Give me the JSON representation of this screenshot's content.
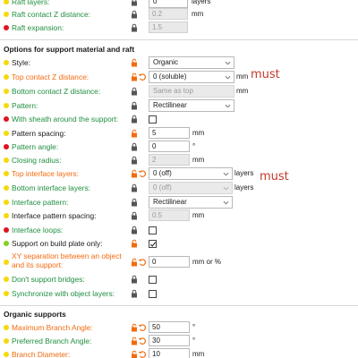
{
  "colors": {
    "dot_yellow": "#f5d90a",
    "dot_red": "#e0141e",
    "dot_green": "#7ed321",
    "label_orange": "#f26b0f",
    "label_green": "#1f8f3f",
    "label_black": "#1a1a1a",
    "annotation_red": "#c0392b"
  },
  "raft": {
    "layers": {
      "label": "Raft layers:",
      "value": "0",
      "unit": "layers"
    },
    "contact_z": {
      "label": "Raft contact Z distance:",
      "value": "0.2",
      "unit": "mm"
    },
    "expansion": {
      "label": "Raft expansion:",
      "value": "1.5"
    }
  },
  "support": {
    "section_title": "Options for support material and raft",
    "style": {
      "label": "Style:",
      "value": "Organic"
    },
    "top_contact_z": {
      "label": "Top contact Z distance:",
      "value": "0 (soluble)",
      "unit": "mm"
    },
    "bottom_contact_z": {
      "label": "Bottom contact Z distance:",
      "value": "Same as top",
      "unit": "mm"
    },
    "pattern": {
      "label": "Pattern:",
      "value": "Rectilinear"
    },
    "with_sheath": {
      "label": "With sheath around the support:"
    },
    "pattern_spacing": {
      "label": "Pattern spacing:",
      "value": "5",
      "unit": "mm"
    },
    "pattern_angle": {
      "label": "Pattern angle:",
      "value": "0",
      "unit": "°"
    },
    "closing_radius": {
      "label": "Closing radius:",
      "value": "2",
      "unit": "mm"
    },
    "top_interface_layers": {
      "label": "Top interface layers:",
      "value": "0 (off)",
      "unit": "layers"
    },
    "bottom_interface_layers": {
      "label": "Bottom interface layers:",
      "value": "0 (off)",
      "unit": "layers"
    },
    "interface_pattern": {
      "label": "Interface pattern:",
      "value": "Rectilinear"
    },
    "interface_pattern_spacing": {
      "label": "Interface pattern spacing:",
      "value": "0.5",
      "unit": "mm"
    },
    "interface_loops": {
      "label": "Interface loops:"
    },
    "build_plate_only": {
      "label": "Support on build plate only:",
      "checked": true
    },
    "xy_separation": {
      "label_line1": "XY separation between an object",
      "label_line2": "and its support:",
      "value": "0",
      "unit": "mm or %"
    },
    "dont_support_bridges": {
      "label": "Don't support bridges:"
    },
    "sync_object_layers": {
      "label": "Synchronize with object layers:"
    }
  },
  "organic": {
    "section_title": "Organic supports",
    "max_branch_angle": {
      "label": "Maximum Branch Angle:",
      "value": "50",
      "unit": "°"
    },
    "preferred_branch_angle": {
      "label": "Preferred Branch Angle:",
      "value": "30",
      "unit": "°"
    },
    "branch_diameter": {
      "label": "Branch Diameter:",
      "value": "10",
      "unit": "mm"
    }
  },
  "annotations": {
    "must_1": "must",
    "must_2": "must"
  }
}
